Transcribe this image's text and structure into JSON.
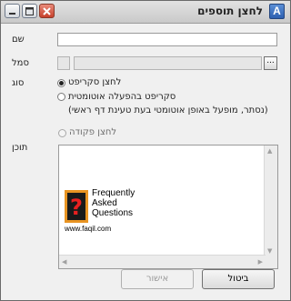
{
  "window": {
    "title": "לחצן תוספים",
    "app_icon": "A"
  },
  "fields": {
    "name_label": "שם",
    "symbol_label": "סמל",
    "type_label": "סוג",
    "content_label": "תוכן",
    "browse_label": "..."
  },
  "type_options": [
    {
      "label": "לחצן סקריפט",
      "selected": true,
      "enabled": true
    },
    {
      "label": "סקריפט בהפעלה אוטומטית",
      "sublabel": "(נסתר, מופעל באופן אוטומטי בעת טעינת דף ראשי)",
      "selected": false,
      "enabled": true
    },
    {
      "label": "לחצן פקודה",
      "selected": false,
      "enabled": false
    }
  ],
  "logo": {
    "line1": "Frequently",
    "line2": "Asked",
    "line3": "Questions",
    "url": "www.faqil.com",
    "mark": "?"
  },
  "buttons": {
    "cancel": "ביטול",
    "ok": "אישור"
  }
}
